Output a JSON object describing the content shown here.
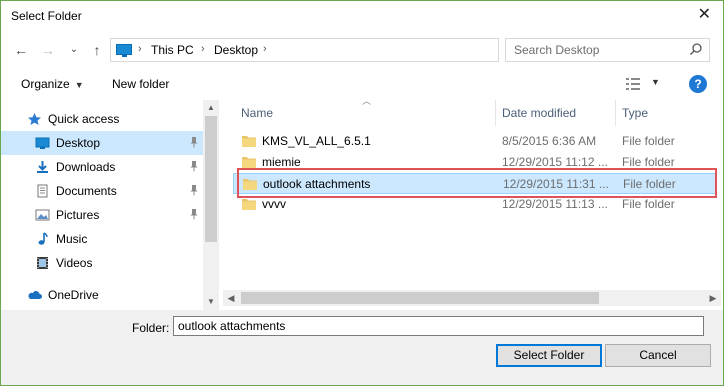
{
  "window": {
    "title": "Select Folder",
    "close_glyph": "✕"
  },
  "address": {
    "crumbs": [
      "This PC",
      "Desktop"
    ],
    "separator": "›",
    "search_placeholder": "Search Desktop"
  },
  "nav_buttons": {
    "back": "←",
    "forward": "→",
    "up": "↑",
    "dropdown": "⌄",
    "refresh": "↻"
  },
  "toolbar": {
    "organize_label": "Organize",
    "new_folder_label": "New folder",
    "help_label": "?"
  },
  "sidebar": {
    "items": [
      {
        "label": "Quick access",
        "icon": "star-icon"
      },
      {
        "label": "Desktop",
        "icon": "desktop-icon",
        "pinned": true,
        "selected": true
      },
      {
        "label": "Downloads",
        "icon": "download-icon",
        "pinned": true
      },
      {
        "label": "Documents",
        "icon": "documents-icon",
        "pinned": true
      },
      {
        "label": "Pictures",
        "icon": "pictures-icon",
        "pinned": true
      },
      {
        "label": "Music",
        "icon": "music-icon"
      },
      {
        "label": "Videos",
        "icon": "videos-icon"
      },
      {
        "label": "OneDrive",
        "icon": "cloud-icon"
      }
    ]
  },
  "columns": {
    "name": "Name",
    "date_modified": "Date modified",
    "type": "Type"
  },
  "files": [
    {
      "name": "KMS_VL_ALL_6.5.1",
      "date": "8/5/2015 6:36 AM",
      "type": "File folder"
    },
    {
      "name": "miemie",
      "date": "12/29/2015 11:12 ...",
      "type": "File folder"
    },
    {
      "name": "outlook attachments",
      "date": "12/29/2015 11:31 ...",
      "type": "File folder",
      "selected": true
    },
    {
      "name": "vvvv",
      "date": "12/29/2015 11:13 ...",
      "type": "File folder"
    }
  ],
  "footer": {
    "folder_label": "Folder:",
    "folder_value": "outlook attachments",
    "select_button": "Select Folder",
    "cancel_button": "Cancel"
  },
  "colors": {
    "selection": "#cce8ff",
    "highlight_border": "#e0525b",
    "accent": "#1e78d4"
  }
}
